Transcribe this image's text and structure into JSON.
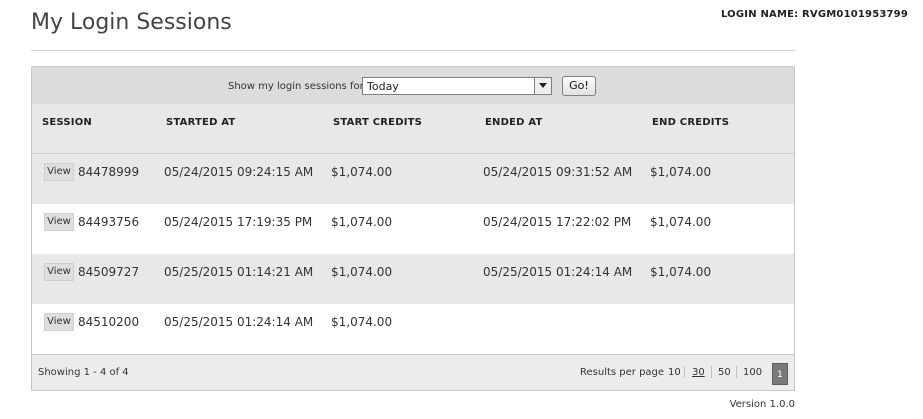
{
  "page": {
    "title": "My Login Sessions",
    "version": "Version 1.0.0"
  },
  "login": {
    "label": "LOGIN NAME: RVGM0101953799"
  },
  "filter": {
    "label": "Show my login sessions for",
    "selected": "Today",
    "go_label": "Go!"
  },
  "table": {
    "columns": [
      "SESSION",
      "STARTED AT",
      "START CREDITS",
      "ENDED AT",
      "END CREDITS"
    ],
    "view_label": "View",
    "rows": [
      {
        "session": "84478999",
        "started_at": "05/24/2015 09:24:15 AM",
        "start_credits": "$1,074.00",
        "ended_at": "05/24/2015 09:31:52 AM",
        "end_credits": "$1,074.00"
      },
      {
        "session": "84493756",
        "started_at": "05/24/2015 17:19:35 PM",
        "start_credits": "$1,074.00",
        "ended_at": "05/24/2015 17:22:02 PM",
        "end_credits": "$1,074.00"
      },
      {
        "session": "84509727",
        "started_at": "05/25/2015 01:14:21 AM",
        "start_credits": "$1,074.00",
        "ended_at": "05/25/2015 01:24:14 AM",
        "end_credits": "$1,074.00"
      },
      {
        "session": "84510200",
        "started_at": "05/25/2015 01:24:14 AM",
        "start_credits": "$1,074.00",
        "ended_at": "",
        "end_credits": ""
      }
    ]
  },
  "footer": {
    "showing": "Showing 1 - 4 of 4",
    "results_per_page_label": "Results per page",
    "options": [
      "10",
      "30",
      "50",
      "100"
    ],
    "active_option": "30",
    "current_page": "1"
  }
}
